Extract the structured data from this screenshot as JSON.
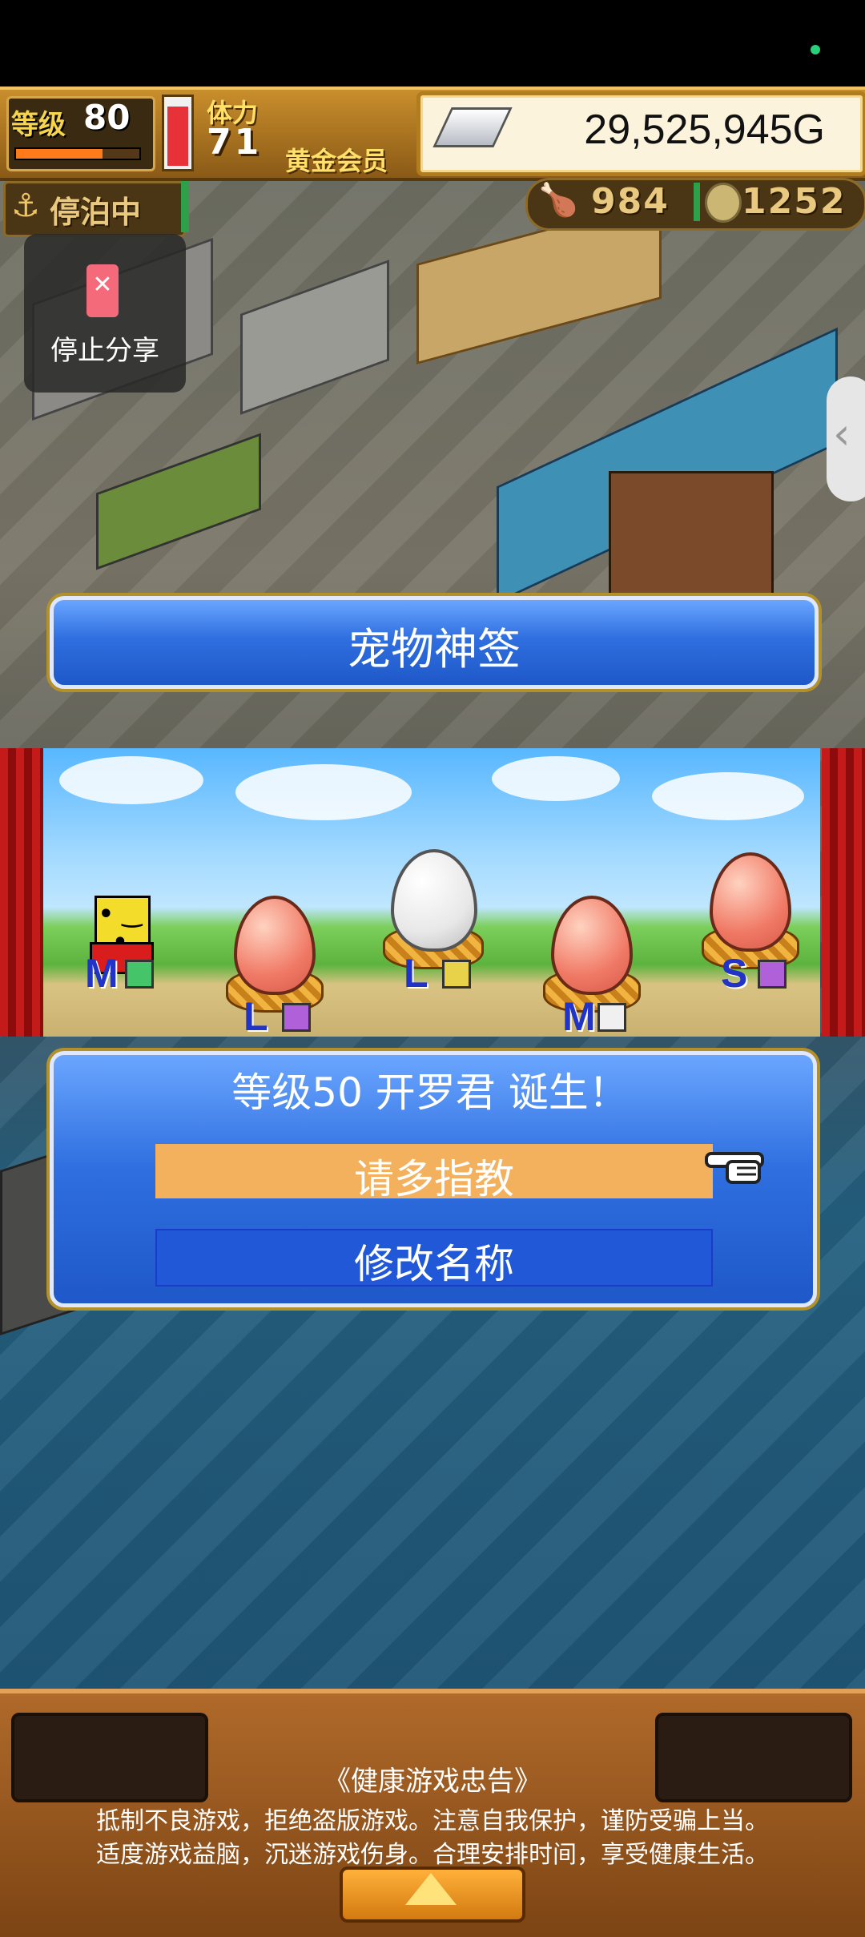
{
  "hud": {
    "level_label": "等级",
    "level_value": "80",
    "level_progress": 0.7,
    "stamina_label": "体力",
    "stamina_value": "71",
    "stamina_fill": 0.95,
    "member_label": "黄金会员",
    "gold_value": "29,525,945G",
    "docked_label": "停泊中",
    "resource1_value": "984",
    "resource2_value": "1252"
  },
  "overlay": {
    "share_label": "停止分享"
  },
  "title": {
    "text": "宠物神签"
  },
  "eggs": [
    {
      "size": "M",
      "color": "mascot",
      "gem": "green"
    },
    {
      "size": "L",
      "color": "pink",
      "gem": "purple"
    },
    {
      "size": "L",
      "color": "white",
      "gem": "yellow"
    },
    {
      "size": "M",
      "color": "pink",
      "gem": "white"
    },
    {
      "size": "S",
      "color": "pink",
      "gem": "purple"
    }
  ],
  "dialog": {
    "title": "等级50 开罗君 诞生！",
    "confirm_label": "请多指教",
    "rename_label": "修改名称"
  },
  "notice": {
    "title": "《健康游戏忠告》",
    "line1": "抵制不良游戏，拒绝盗版游戏。注意自我保护，谨防受骗上当。",
    "line2": "适度游戏益脑，沉迷游戏伤身。合理安排时间，享受健康生活。"
  },
  "colors": {
    "accent_blue": "#2f6fe0",
    "confirm_orange": "#f3b15d",
    "gold_frame": "#b07c1e"
  }
}
